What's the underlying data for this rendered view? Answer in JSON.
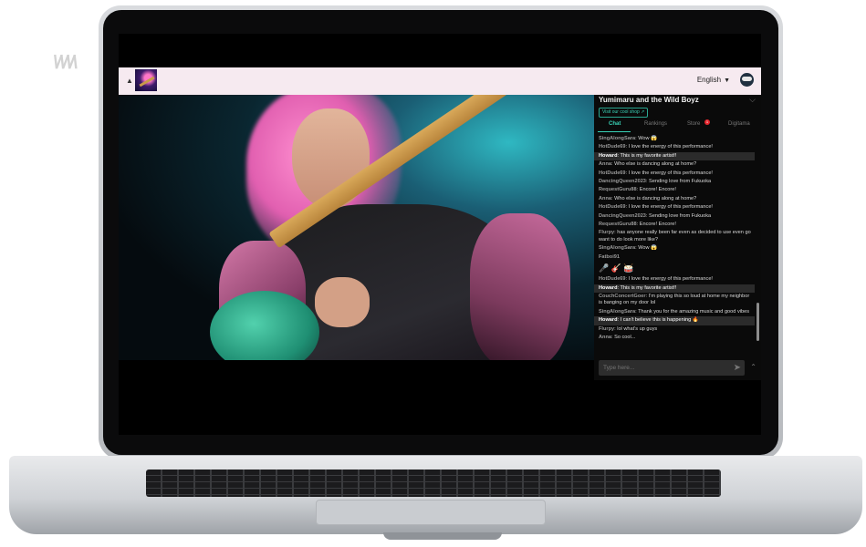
{
  "watermark": "\\/\\/\\/\\",
  "header": {
    "language": "English"
  },
  "channel": {
    "artist": "Yumimaru and the Wild Boyz",
    "shop_label": "Visit our cool shop",
    "tabs": [
      {
        "label": "Chat",
        "active": true
      },
      {
        "label": "Rankings",
        "active": false
      },
      {
        "label": "Store",
        "active": false,
        "badge": "1"
      },
      {
        "label": "Digitama",
        "active": false
      }
    ]
  },
  "chat": {
    "messages": [
      {
        "user": "SingAlongSara",
        "text": "Wow 😱",
        "highlight": false
      },
      {
        "user": "HotDude69",
        "text": "I love the energy of this performance!",
        "highlight": false
      },
      {
        "user": "Howard",
        "text": "This is my favorite artist!!",
        "highlight": true
      },
      {
        "user": "Anna",
        "text": "Who else is dancing along at home?",
        "highlight": false
      },
      {
        "user": "HotDude69",
        "text": "I love the energy of this performance!",
        "highlight": false
      },
      {
        "user": "DancingQueen2023",
        "text": "Sending love from Fukuoka",
        "highlight": false
      },
      {
        "user": "RequestGuru88",
        "text": "Encore! Encore!",
        "highlight": false
      },
      {
        "user": "Anna",
        "text": "Who else is dancing along at home?",
        "highlight": false
      },
      {
        "user": "HotDude69",
        "text": "I love the energy of this performance!",
        "highlight": false
      },
      {
        "user": "DancingQueen2023",
        "text": "Sending love from Fukuoka",
        "highlight": false
      },
      {
        "user": "RequestGuru88",
        "text": "Encore! Encore!",
        "highlight": false
      },
      {
        "user": "Flurpy",
        "text": "has anyone really been far even as decided to use even go want to do look more like?",
        "highlight": false
      },
      {
        "user": "SingAlongSara",
        "text": "Wow 😱",
        "highlight": false
      },
      {
        "user": "Fatboi91",
        "text": "",
        "highlight": false
      },
      {
        "stickers": "🎤 🎸 🥁"
      },
      {
        "user": "HotDude69",
        "text": "I love the energy of this performance!",
        "highlight": false
      },
      {
        "user": "Howard",
        "text": "This is my favorite artist!!",
        "highlight": true
      },
      {
        "user": "CouchConcertGoer",
        "text": "I'm playing this so loud at home my neighbor is banging on my door lol",
        "highlight": false
      },
      {
        "user": "SingAlongSara",
        "text": "Thank you for the amazing music and good vibes",
        "highlight": false
      },
      {
        "user": "Howard",
        "text": "I can't believe this is happening 🔥",
        "highlight": true
      },
      {
        "user": "Flurpy",
        "text": "lol what's up guys",
        "highlight": false
      },
      {
        "user": "Anna",
        "text": "So cool...",
        "highlight": false
      }
    ],
    "placeholder": "Type here..."
  },
  "colors": {
    "accent": "#39d2b6",
    "header_bg": "#f6eaf0",
    "badge": "#e5262e"
  },
  "icons": [
    "chevron-up-icon",
    "caret-down-icon",
    "avatar-icon",
    "chevron-down-icon",
    "external-link-icon",
    "send-icon"
  ]
}
